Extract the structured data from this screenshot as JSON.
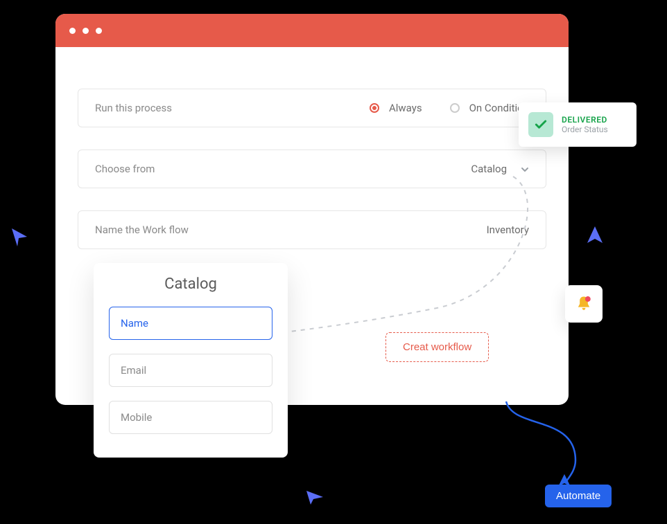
{
  "form": {
    "run_label": "Run this process",
    "option_always": "Always",
    "option_condition": "On Condition",
    "choose_label": "Choose from",
    "choose_value": "Catalog",
    "name_label": "Name the Work flow",
    "name_value": "Inventory"
  },
  "catalog": {
    "title": "Catalog",
    "fields": [
      "Name",
      "Email",
      "Mobile"
    ]
  },
  "create_btn": "Creat workflow",
  "delivered": {
    "title": "DELIVERED",
    "subtitle": "Order Status"
  },
  "automate_btn": "Automate"
}
